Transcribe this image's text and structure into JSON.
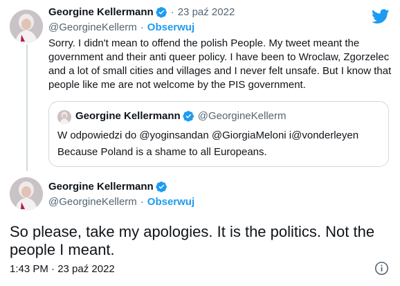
{
  "tweet1": {
    "name": "Georgine Kellermann",
    "separator": "·",
    "date": "23 paź 2022",
    "handle": "@GeorgineKellerm",
    "dot": "·",
    "follow_label": "Obserwuj",
    "text": "Sorry. I didn't mean to offend the polish People. My tweet meant the government and their anti queer policy. I have been to Wroclaw, Zgorzelec and a lot of small cities and villages and I never felt unsafe. But I know that people like me are not welcome by the PIS government."
  },
  "quote": {
    "name": "Georgine Kellermann",
    "handle": "@GeorgineKellerm",
    "reply_to": "W odpowiedzi do @yoginsandan @GiorgiaMeloni i@vonderleyen",
    "text": "Because Poland is a shame to all Europeans."
  },
  "tweet2": {
    "name": "Georgine Kellermann",
    "handle": "@GeorgineKellerm",
    "dot": "·",
    "follow_label": "Obserwuj",
    "text": "So please, take my apologies. It is the politics. Not the people I meant.",
    "timestamp": "1:43 PM · 23 paź 2022"
  },
  "icons": {
    "logo": "twitter-bird-icon",
    "verified": "verified-badge-icon",
    "info": "info-icon"
  },
  "colors": {
    "accent": "#1d9bf0",
    "text": "#0f1419",
    "secondary": "#536471",
    "border": "#cfd9de"
  }
}
